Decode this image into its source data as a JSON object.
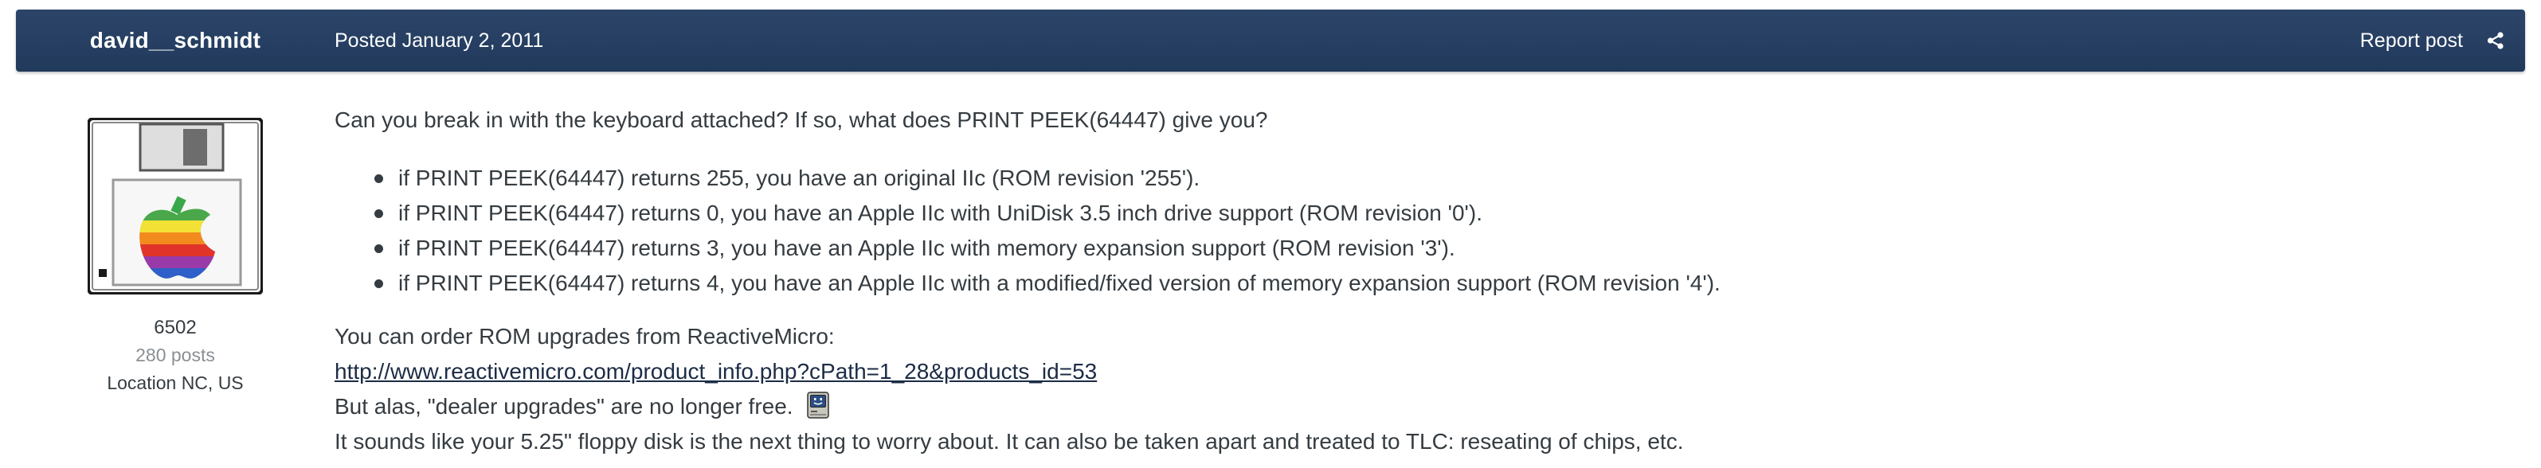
{
  "header": {
    "author_name": "david__schmidt",
    "posted_date": "Posted January 2, 2011",
    "report_label": "Report post",
    "share_icon": "share-icon",
    "background_color": "#243c5f"
  },
  "author": {
    "avatar_icon": "apple-floppy-avatar-icon",
    "title": "6502",
    "posts": "280 posts",
    "location": "Location NC, US"
  },
  "post": {
    "intro": "Can you break in with the keyboard attached? If so, what does PRINT PEEK(64447) give you?",
    "rom_items": [
      "if PRINT PEEK(64447) returns 255, you have an original IIc (ROM revision '255').",
      "if PRINT PEEK(64447) returns 0, you have an Apple IIc with UniDisk 3.5 inch drive support (ROM revision '0').",
      "if PRINT PEEK(64447) returns 3, you have an Apple IIc with memory expansion support (ROM revision '3').",
      "if PRINT PEEK(64447) returns 4, you have an Apple IIc with a modified/fixed version of memory expansion support (ROM revision '4')."
    ],
    "upgrade_text": "You can order ROM upgrades from ReactiveMicro:",
    "link_text": "http://www.reactivemicro.com/product_info.php?cPath=1_28&products_id=53",
    "alas_text": "But alas, \"dealer upgrades\" are no longer free.",
    "emoji_icon": "mac-computer-emoji-icon",
    "floppy_text": "It sounds like your 5.25\" floppy disk is the next thing to worry about. It can also be taken apart and treated to TLC: reseating of chips, etc."
  }
}
